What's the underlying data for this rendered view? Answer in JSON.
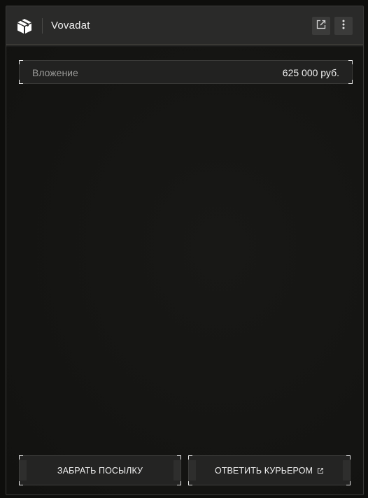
{
  "window": {
    "title": "Vovadat",
    "app_icon": "package-icon",
    "actions": [
      {
        "icon": "external-link-icon"
      },
      {
        "icon": "more-vertical-icon"
      }
    ]
  },
  "details": {
    "label": "Вложение",
    "value": "625 000 руб."
  },
  "buttons": {
    "take_label": "ЗАБРАТЬ ПОСЫЛКУ",
    "reply_label": "ОТВЕТИТЬ КУРЬЕРОМ",
    "reply_icon": "external-link-icon"
  },
  "colors": {
    "background": "#1a1a19",
    "titlebar": "#2a2a29",
    "text": "#f0f0f0",
    "muted_text": "#9a9a98"
  }
}
